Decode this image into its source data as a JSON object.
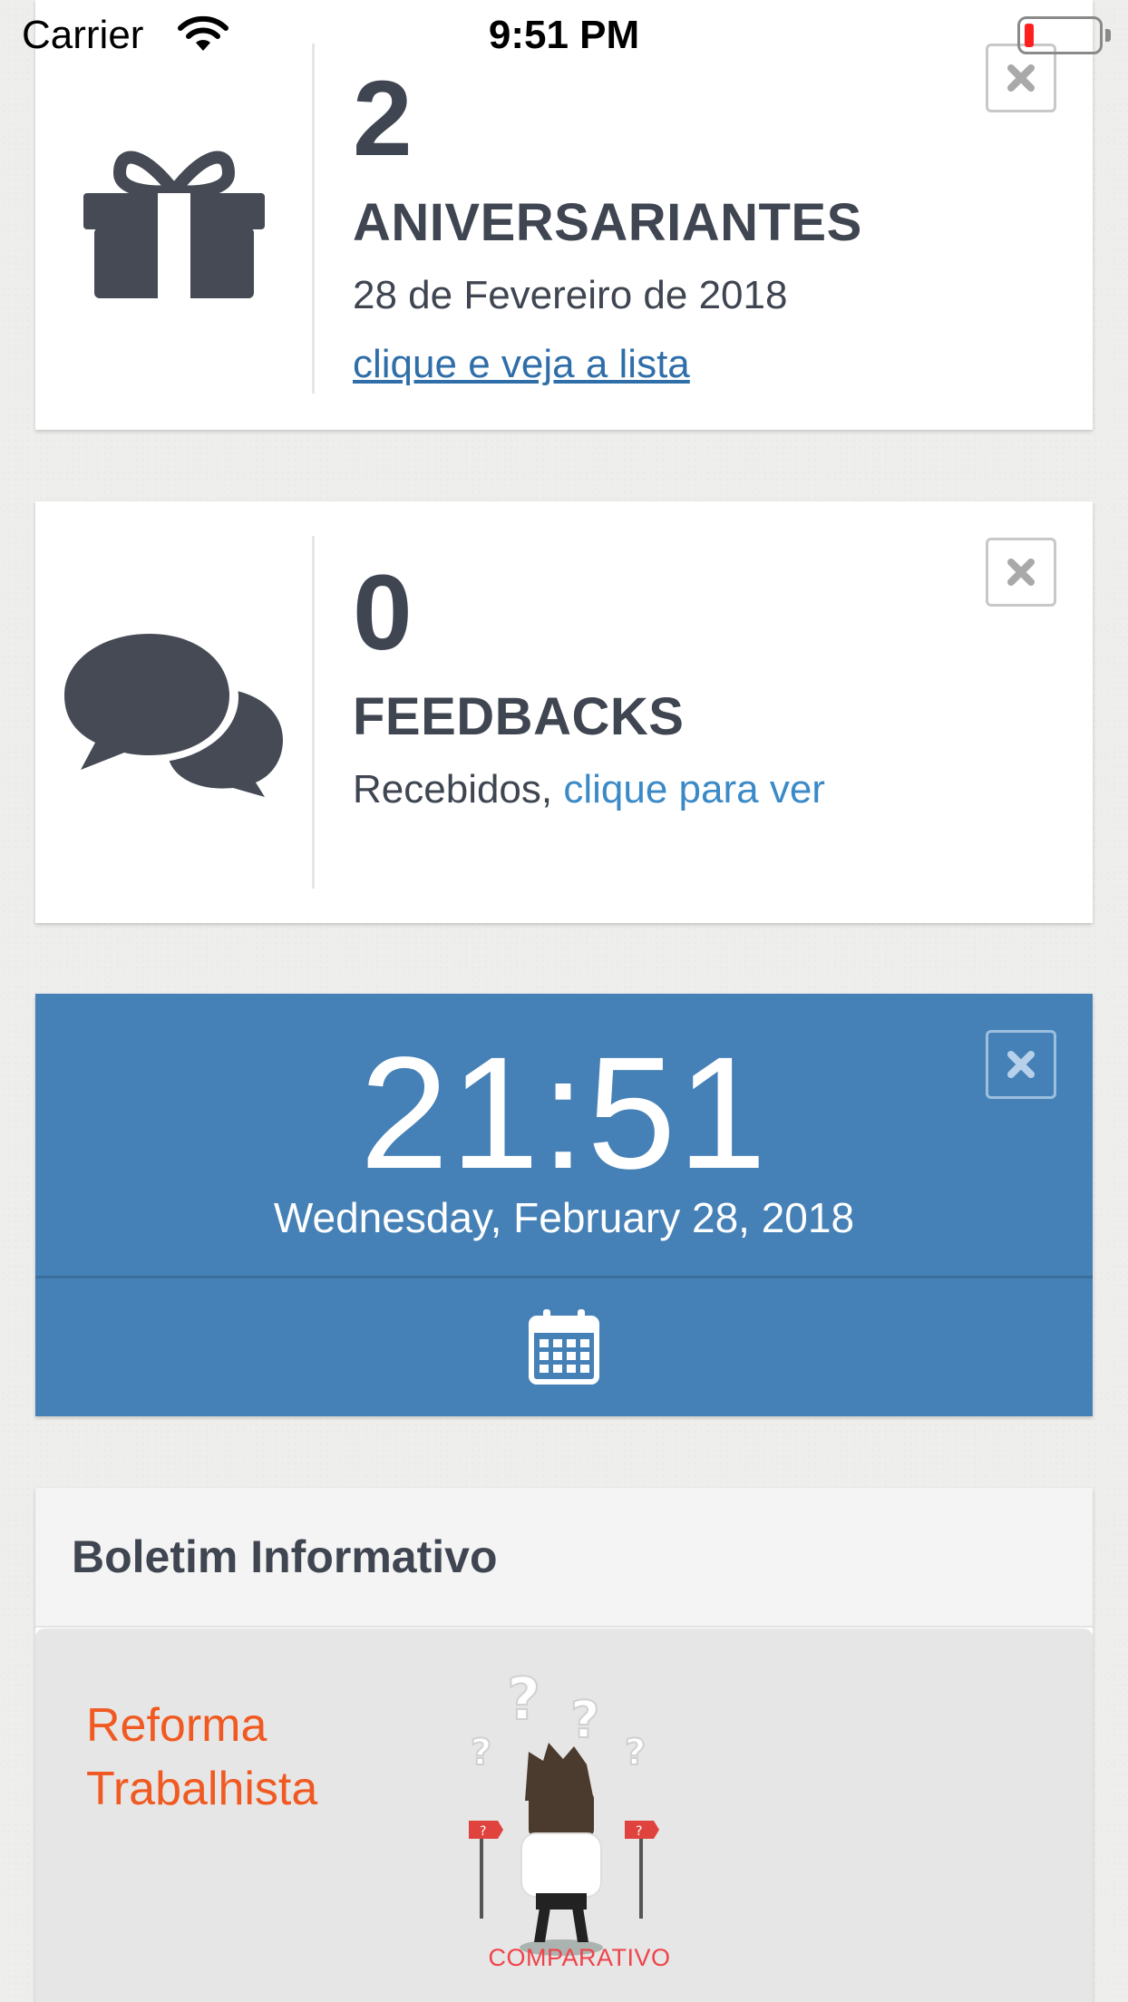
{
  "status_bar": {
    "carrier": "Carrier",
    "time": "9:51 PM",
    "battery_level": 0.12
  },
  "birthdays_card": {
    "count": "2",
    "title": "ANIVERSARIANTES",
    "date": "28 de Fevereiro de 2018",
    "link": "clique e veja a lista",
    "icon": "gift-icon"
  },
  "feedbacks_card": {
    "count": "0",
    "title": "FEEDBACKS",
    "prefix": "Recebidos, ",
    "link": "clique para ver",
    "icon": "chat-bubbles-icon"
  },
  "clock_card": {
    "time": "21:51",
    "date": "Wednesday, February 28, 2018",
    "icon": "calendar-icon"
  },
  "newsletter": {
    "title": "Boletim Informativo",
    "banner_line1": "Reforma",
    "banner_line2": "Trabalhista",
    "banner_caption": "COMPARATIVO"
  },
  "colors": {
    "blue_card": "#4581b6",
    "text_dark": "#3f4651",
    "link": "#2f6ea8",
    "banner_orange": "#f05a22"
  }
}
